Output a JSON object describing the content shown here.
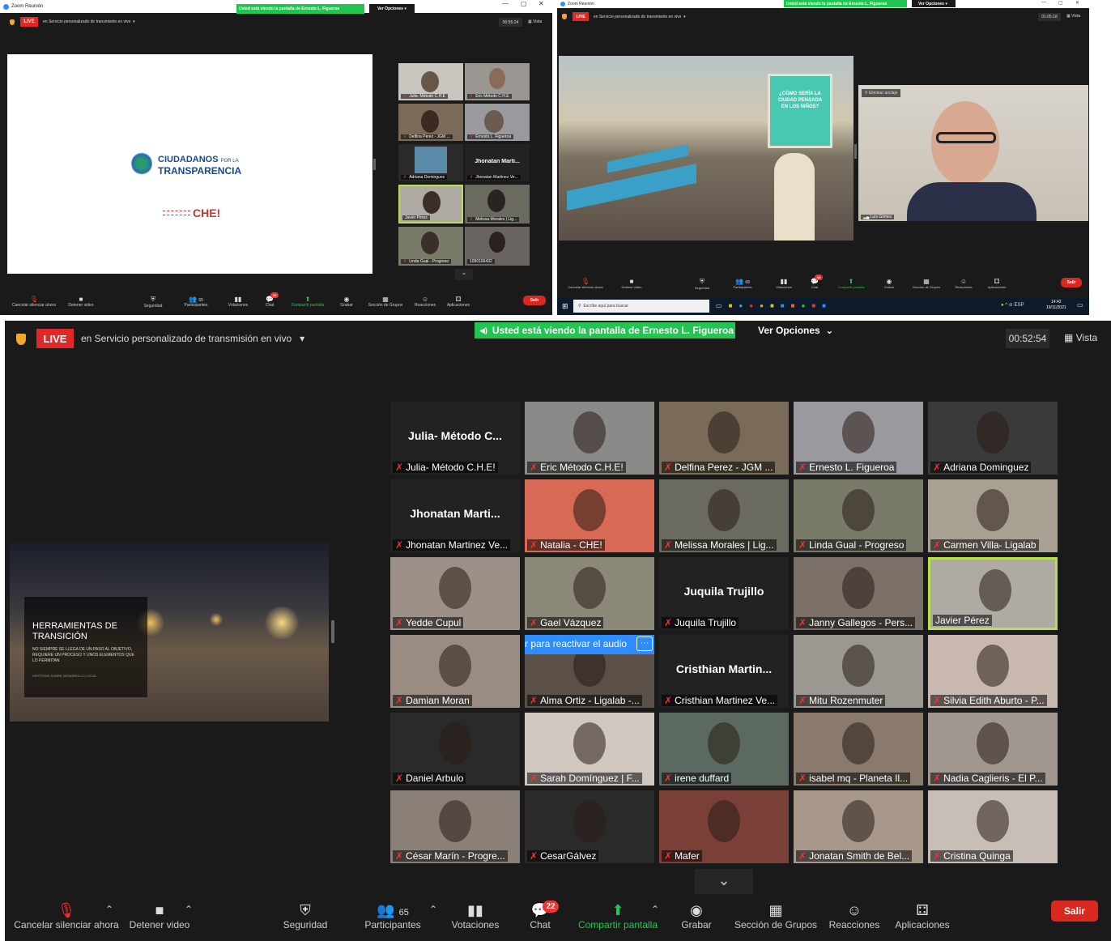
{
  "top_left": {
    "window_title": "Zoom Reunión",
    "share_banner": "Usted está viendo la pantalla de Ernesto L. Figueroa",
    "options": "Ver Opciones",
    "live": "LIVE",
    "stream": "en Servicio personalizado de transmisión en vivo",
    "timer": "00:55:24",
    "view": "Vista",
    "slide_logo_line1": "CIUDADANOS",
    "slide_logo_small": "POR LA",
    "slide_logo_line2": "TRANSPARENCIA",
    "slide_che": "CHE!",
    "tiles": [
      {
        "name": "Julia- Método C.H.E"
      },
      {
        "name": "Eric Método C.H.E"
      },
      {
        "name": "Delfina Perez - JGM ..."
      },
      {
        "name": "Ernesto L. Figueroa"
      },
      {
        "name": "Adriana Dominguez"
      },
      {
        "name": "Jhonatan Martinez Ve...",
        "big": "Jhonatan Marti..."
      },
      {
        "name": "Javier Pérez"
      },
      {
        "name": "Melissa Morales | Lig..."
      },
      {
        "name": "Linda Gual - Progreso"
      },
      {
        "name": "1090166432"
      }
    ],
    "toolbar": [
      "Cancelar silenciar ahora",
      "Detener video",
      "Seguridad",
      "Participantes",
      "Votaciones",
      "Chat",
      "Compartir pantalla",
      "Grabar",
      "Sección de Grupos",
      "Reacciones",
      "Aplicaciones"
    ],
    "participants_count": "65",
    "chat_badge": "22",
    "leave": "Salir"
  },
  "top_right": {
    "window_title": "Zoom Reunión",
    "share_banner": "Usted está viendo la pantalla de Ernesto L. Figueroa",
    "options": "Ver Opciones",
    "live": "LIVE",
    "stream": "en Servicio personalizado de transmisión en vivo",
    "timer": "01:05:18",
    "view": "Vista",
    "sign_text": "¿CÓMO SERÍA LA CIUDAD PENSADA EN LOS NIÑOS?",
    "unpin": "Eliminar anclaje",
    "speaker_name": "Luis Gómez",
    "toolbar": [
      "Cancelar silenciar ahora",
      "Detener video",
      "Seguridad",
      "Participantes",
      "Votaciones",
      "Chat",
      "Compartir pantalla",
      "Grabar",
      "Sección de Grupos",
      "Reacciones",
      "Aplicaciones"
    ],
    "participants_count": "68",
    "chat_badge": "24",
    "leave": "Salir",
    "taskbar_search": "Escribe aquí para buscar",
    "taskbar_lang": "ESP",
    "taskbar_time": "14:42",
    "taskbar_date": "19/11/2021"
  },
  "main": {
    "live": "LIVE",
    "stream": "en Servicio personalizado de transmisión en vivo",
    "share_banner": "Usted está viendo la pantalla de Ernesto L. Figueroa",
    "options": "Ver Opciones",
    "timer": "00:52:54",
    "view": "Vista",
    "slide_title": "HERRAMIENTAS DE TRANSICIÓN",
    "slide_body": "NO SIEMPRE SE LLEGA DE UN PASO AL OBJETIVO, REQUIERE UN PROCESO Y UNOS ELEMENTOS QUE LO PERMITAN",
    "slide_foot": "HIPÓTESIS SOBRE DESARROLLO LOCAL",
    "audio_banner": "r para reactivar el audio",
    "tiles": [
      {
        "name": "Julia- Método C.H.E!",
        "big": "Julia- Método C...",
        "bg": "#222222"
      },
      {
        "name": "Eric Método C.H.E!",
        "bg": "#8a8a88"
      },
      {
        "name": "Delfina Perez - JGM ...",
        "bg": "#7a6a58"
      },
      {
        "name": "Ernesto L. Figueroa",
        "bg": "#9a9a9e"
      },
      {
        "name": "Adriana Dominguez",
        "bg": "#3a3a3a"
      },
      {
        "name": "Jhonatan Martinez Ve...",
        "big": "Jhonatan Marti...",
        "bg": "#222222"
      },
      {
        "name": "Natalia - CHE!",
        "bg": "#d86a55"
      },
      {
        "name": "Melissa Morales | Lig...",
        "bg": "#6a6a60"
      },
      {
        "name": "Linda Gual - Progreso",
        "bg": "#7a7a68"
      },
      {
        "name": "Carmen Villa- Ligalab",
        "bg": "#a8a090"
      },
      {
        "name": "Yedde Cupul",
        "bg": "#9c9088"
      },
      {
        "name": "Gael Vázquez",
        "bg": "#8c8878"
      },
      {
        "name": "Juquila Trujillo",
        "big": "Juquila Trujillo",
        "bg": "#222222"
      },
      {
        "name": "Janny Gallegos - Pers...",
        "bg": "#7a7068"
      },
      {
        "name": "Javier Pérez",
        "bg": "#b0aaa4"
      },
      {
        "name": "Damian Moran",
        "bg": "#9a8c80"
      },
      {
        "name": "Alma Ortiz - Ligalab -...",
        "bg": "#5a5048"
      },
      {
        "name": "Cristhian Martinez Ve...",
        "big": "Cristhian Martin...",
        "bg": "#222222"
      },
      {
        "name": "Mitu Rozenmuter",
        "bg": "#9a9890"
      },
      {
        "name": "Silvia Edith Aburto - P...",
        "bg": "#c8b8b0"
      },
      {
        "name": "Daniel Arbulo",
        "bg": "#2a2a2a"
      },
      {
        "name": "Sarah Domínguez | F...",
        "bg": "#d0c8c0"
      },
      {
        "name": "irene duffard",
        "bg": "#5a6a60"
      },
      {
        "name": "isabel mq - Planeta Il...",
        "bg": "#8a7a6c"
      },
      {
        "name": "Nadia Caglieris - El P...",
        "bg": "#a09890"
      },
      {
        "name": "César Marín - Progre...",
        "bg": "#8a8078"
      },
      {
        "name": "CesarGálvez",
        "bg": "#2a2a2a"
      },
      {
        "name": "Mafer",
        "bg": "#7a4038"
      },
      {
        "name": "Jonatan Smith de Bel...",
        "bg": "#a8988a"
      },
      {
        "name": "Cristina Quinga",
        "bg": "#c8beb8"
      }
    ],
    "toolbar": {
      "mute": "Cancelar silenciar ahora",
      "video": "Detener video",
      "security": "Seguridad",
      "participants": "Participantes",
      "participants_count": "65",
      "polls": "Votaciones",
      "chat": "Chat",
      "chat_badge": "22",
      "share": "Compartir pantalla",
      "record": "Grabar",
      "breakout": "Sección de Grupos",
      "reactions": "Reacciones",
      "apps": "Aplicaciones",
      "leave": "Salir"
    }
  }
}
